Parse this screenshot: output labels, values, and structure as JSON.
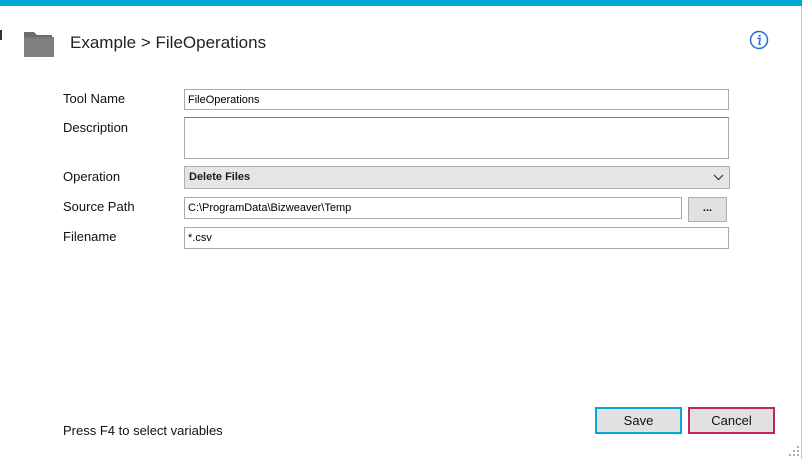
{
  "header": {
    "breadcrumb": "Example > FileOperations",
    "folder_icon": "folder-icon",
    "info_icon": "info-icon",
    "accent_color": "#00a8d6"
  },
  "form": {
    "tool_name": {
      "label": "Tool Name",
      "value": "FileOperations"
    },
    "description": {
      "label": "Description",
      "value": ""
    },
    "operation": {
      "label": "Operation",
      "selected": "Delete Files"
    },
    "source_path": {
      "label": "Source Path",
      "value": "C:\\ProgramData\\Bizweaver\\Temp",
      "browse_label": "..."
    },
    "filename": {
      "label": "Filename",
      "value": "*.csv"
    }
  },
  "footer": {
    "hint": "Press F4 to select variables",
    "save_label": "Save",
    "cancel_label": "Cancel",
    "save_border_color": "#00a8d6",
    "cancel_border_color": "#c4265a"
  }
}
